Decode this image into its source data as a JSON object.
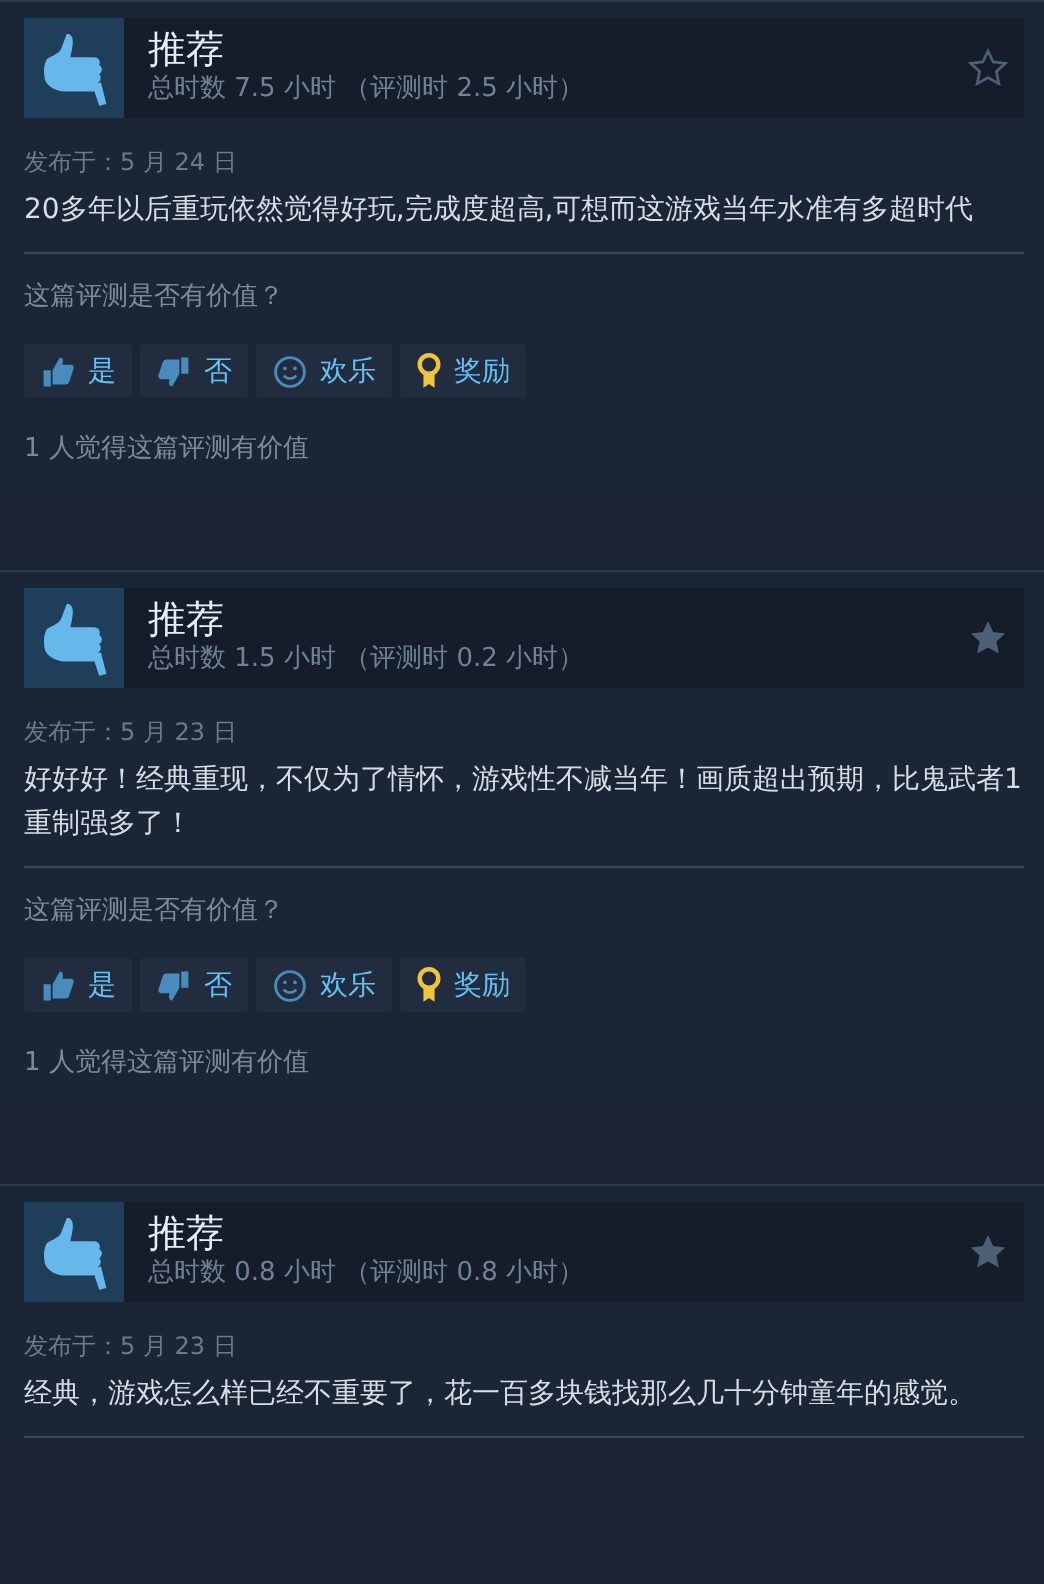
{
  "reviews": [
    {
      "verdict": "推荐",
      "hours": "总时数 7.5 小时",
      "review_hours": "（评测时 2.5 小时）",
      "starred": false,
      "posted": "发布于：5 月 24 日",
      "text": "20多年以后重玩依然觉得好玩,完成度超高,可想而这游戏当年水准有多超时代",
      "helpful_prompt": "这篇评测是否有价值？",
      "buttons": [
        {
          "kind": "yes",
          "label": "是"
        },
        {
          "kind": "no",
          "label": "否"
        },
        {
          "kind": "funny",
          "label": "欢乐"
        },
        {
          "kind": "award",
          "label": "奖励"
        }
      ],
      "helpful_count": "1 人觉得这篇评测有价值"
    },
    {
      "verdict": "推荐",
      "hours": "总时数 1.5 小时",
      "review_hours": "（评测时 0.2 小时）",
      "starred": true,
      "posted": "发布于：5 月 23 日",
      "text": "好好好！经典重现，不仅为了情怀，游戏性不减当年！画质超出预期，比鬼武者1重制强多了！",
      "helpful_prompt": "这篇评测是否有价值？",
      "buttons": [
        {
          "kind": "yes",
          "label": "是"
        },
        {
          "kind": "no",
          "label": "否"
        },
        {
          "kind": "funny",
          "label": "欢乐"
        },
        {
          "kind": "award",
          "label": "奖励"
        }
      ],
      "helpful_count": "1 人觉得这篇评测有价值"
    },
    {
      "verdict": "推荐",
      "hours": "总时数 0.8 小时",
      "review_hours": "（评测时 0.8 小时）",
      "starred": true,
      "posted": "发布于：5 月 23 日",
      "text": "经典，游戏怎么样已经不重要了，花一百多块钱找那么几十分钟童年的感觉。"
    }
  ]
}
